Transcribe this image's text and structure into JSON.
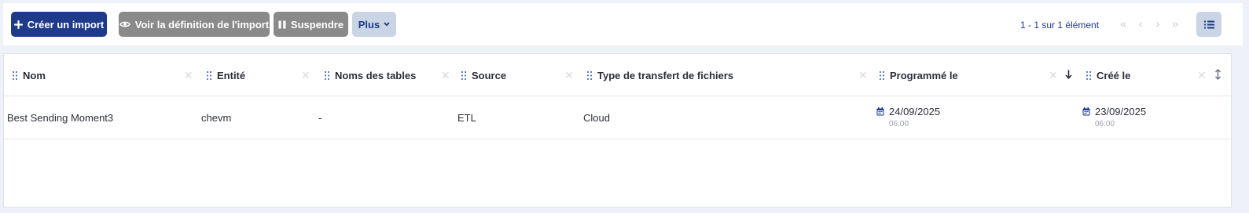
{
  "toolbar": {
    "create_label": "Créer un import",
    "view_definition_label": "Voir la définition de l'import",
    "suspend_label": "Suspendre",
    "more_label": "Plus",
    "pagination_text": "1 - 1 sur 1 élément",
    "pager_first": "«",
    "pager_prev": "‹",
    "pager_next": "›",
    "pager_last": "»"
  },
  "columns": [
    {
      "label": "Nom"
    },
    {
      "label": "Entité"
    },
    {
      "label": "Noms des tables"
    },
    {
      "label": "Source"
    },
    {
      "label": "Type de transfert de fichiers"
    },
    {
      "label": "Programmé le"
    },
    {
      "label": "Créé le"
    }
  ],
  "rows": [
    {
      "nom": "Best Sending Moment3",
      "entite": "chevm",
      "tables": "-",
      "source": "ETL",
      "transfer_type": "Cloud",
      "scheduled_date": "24/09/2025",
      "scheduled_time": "06:00",
      "created_date": "23/09/2025",
      "created_time": "06:00"
    }
  ],
  "colors": {
    "primary": "#1e3a8a",
    "grey_button": "#8a8a8a",
    "light_button": "#c9d4e4",
    "background": "#eef1f7"
  }
}
